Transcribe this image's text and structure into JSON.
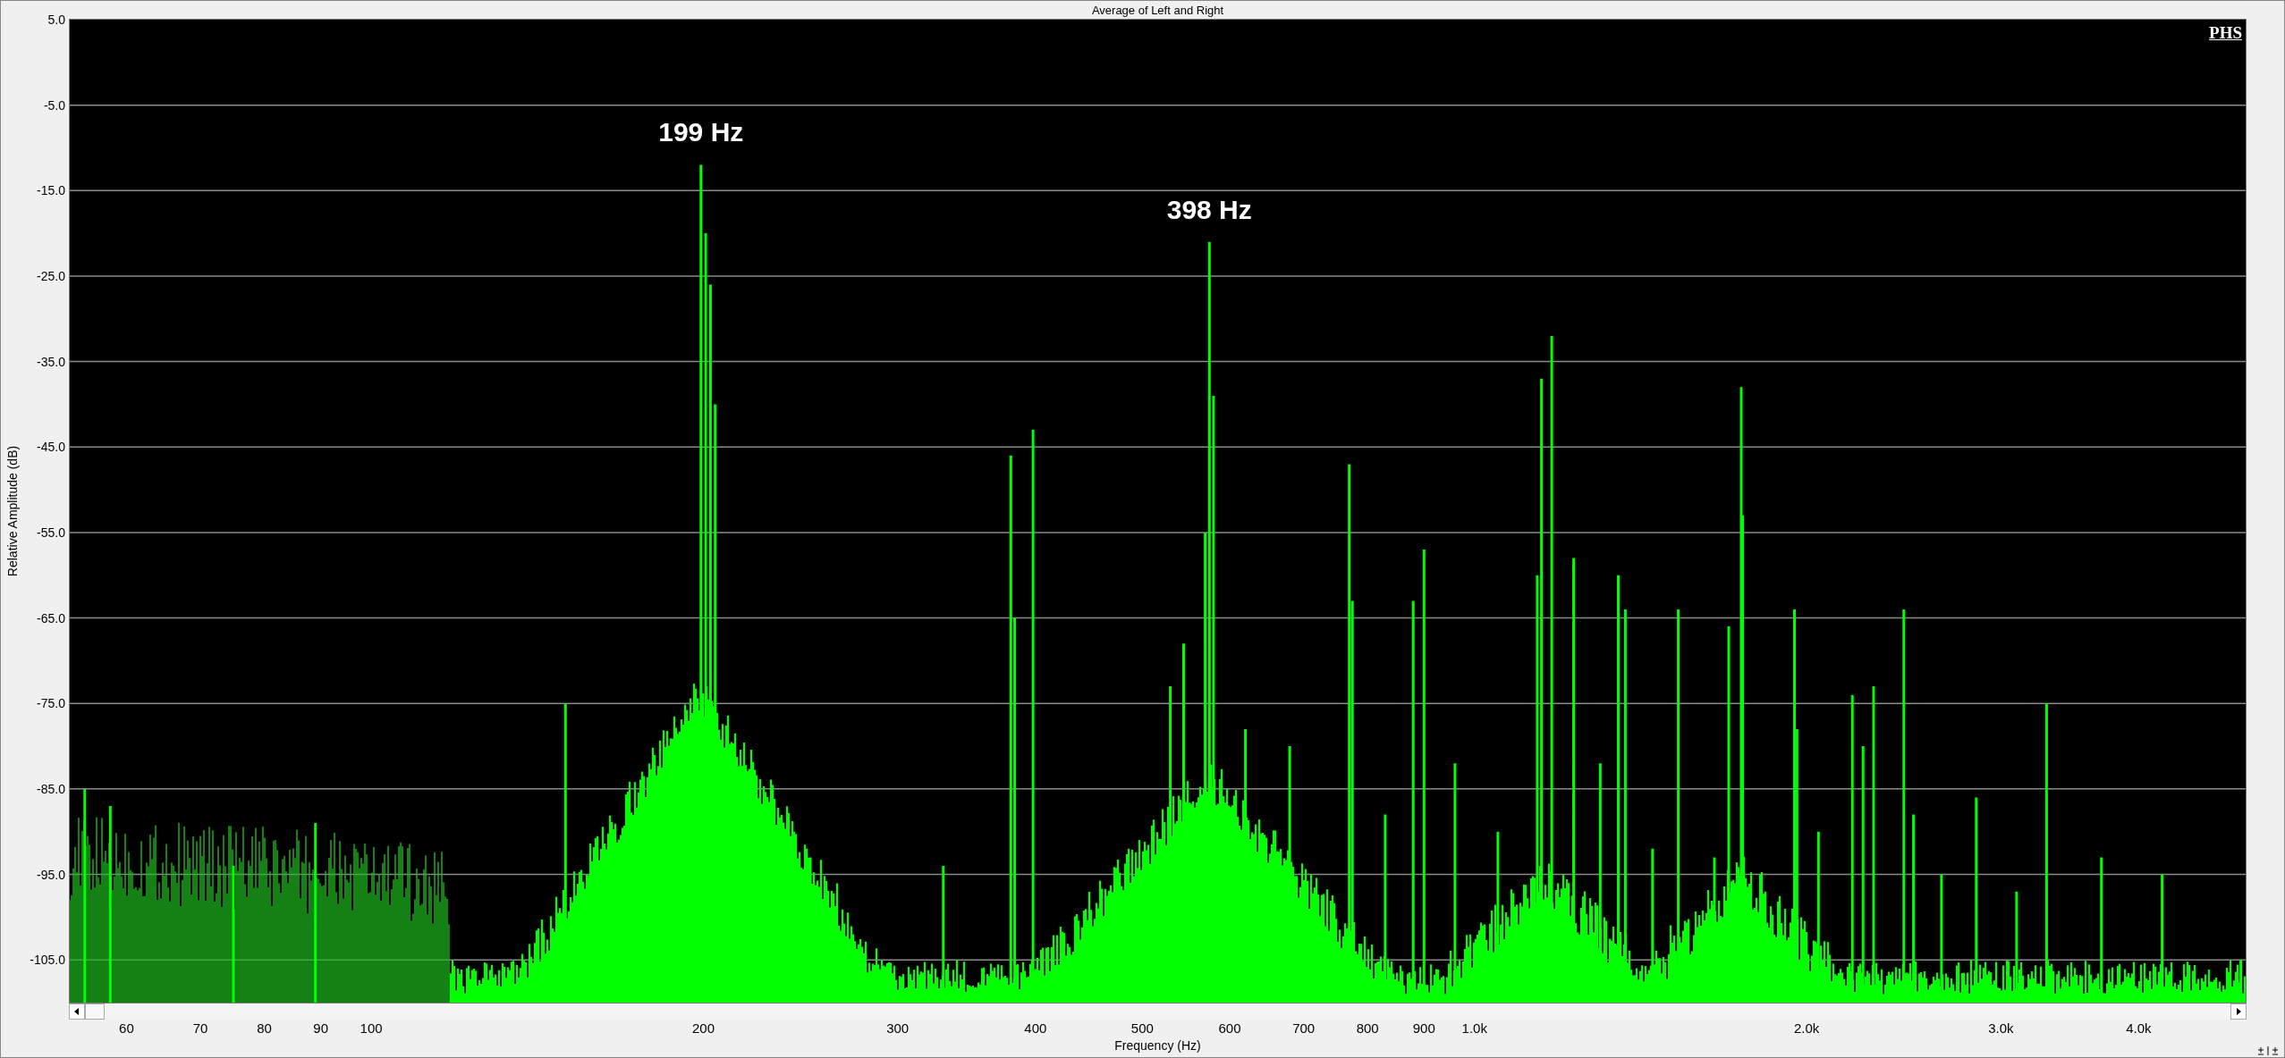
{
  "window": {
    "title": "Average of Left and Right"
  },
  "badge": "PHS",
  "y_axis": {
    "label": "Relative Amplitude (dB)",
    "ticks": [
      "5.0",
      "-5.0",
      "-15.0",
      "-25.0",
      "-35.0",
      "-45.0",
      "-55.0",
      "-65.0",
      "-75.0",
      "-85.0",
      "-95.0",
      "-105.0"
    ]
  },
  "x_axis": {
    "label": "Frequency (Hz)",
    "ticks": [
      "60",
      "70",
      "80",
      "90",
      "100",
      "200",
      "300",
      "400",
      "500",
      "600",
      "700",
      "800",
      "900",
      "1.0k",
      "2.0k",
      "3.0k",
      "4.0k"
    ]
  },
  "annotations": [
    {
      "text": "199 Hz"
    },
    {
      "text": "398 Hz"
    }
  ]
}
